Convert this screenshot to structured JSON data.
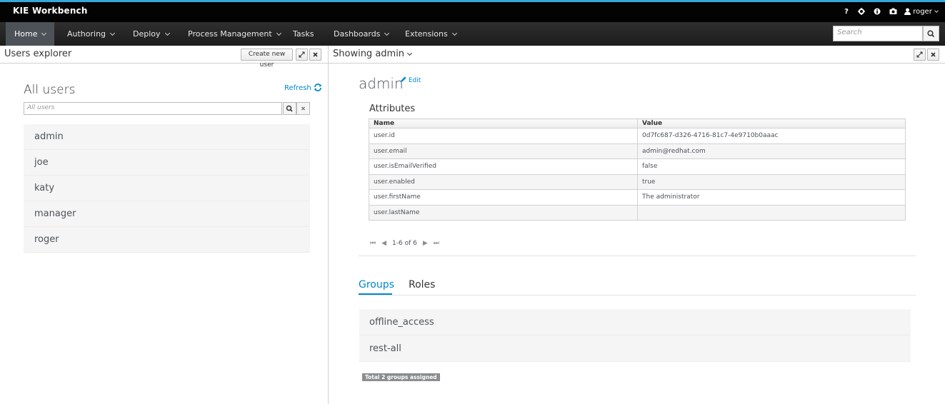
{
  "app": {
    "title": "KIE Workbench"
  },
  "utilities": {
    "help": "?",
    "user": "roger"
  },
  "nav": {
    "items": [
      {
        "label": "Home"
      },
      {
        "label": "Authoring"
      },
      {
        "label": "Deploy"
      },
      {
        "label": "Process Management"
      },
      {
        "label": "Tasks"
      },
      {
        "label": "Dashboards"
      },
      {
        "label": "Extensions"
      }
    ],
    "search_placeholder": "Search"
  },
  "left_panel": {
    "title": "Users explorer",
    "create_button": "Create new user",
    "heading": "All users",
    "refresh": "Refresh",
    "filter_placeholder": "All users",
    "users": [
      "admin",
      "joe",
      "katy",
      "manager",
      "roger"
    ]
  },
  "right_panel": {
    "title": "Showing admin",
    "username": "admin",
    "edit": "Edit",
    "attributes_title": "Attributes",
    "columns": [
      "Name",
      "Value"
    ],
    "rows": [
      [
        "user.id",
        "0d7fc687-d326-4716-81c7-4e9710b0aaac"
      ],
      [
        "user.email",
        "admin@redhat.com"
      ],
      [
        "user.isEmailVerified",
        "false"
      ],
      [
        "user.enabled",
        "true"
      ],
      [
        "user.firstName",
        "The administrator"
      ],
      [
        "user.lastName",
        ""
      ]
    ],
    "pager": "1-6 of 6",
    "tabs": [
      "Groups",
      "Roles"
    ],
    "groups": [
      "offline_access",
      "rest-all"
    ],
    "groups_badge": "Total 2 groups assigned"
  },
  "colors": {
    "accent": "#0088ce",
    "topbar": "#030303",
    "nav_active": "#4d5258"
  }
}
